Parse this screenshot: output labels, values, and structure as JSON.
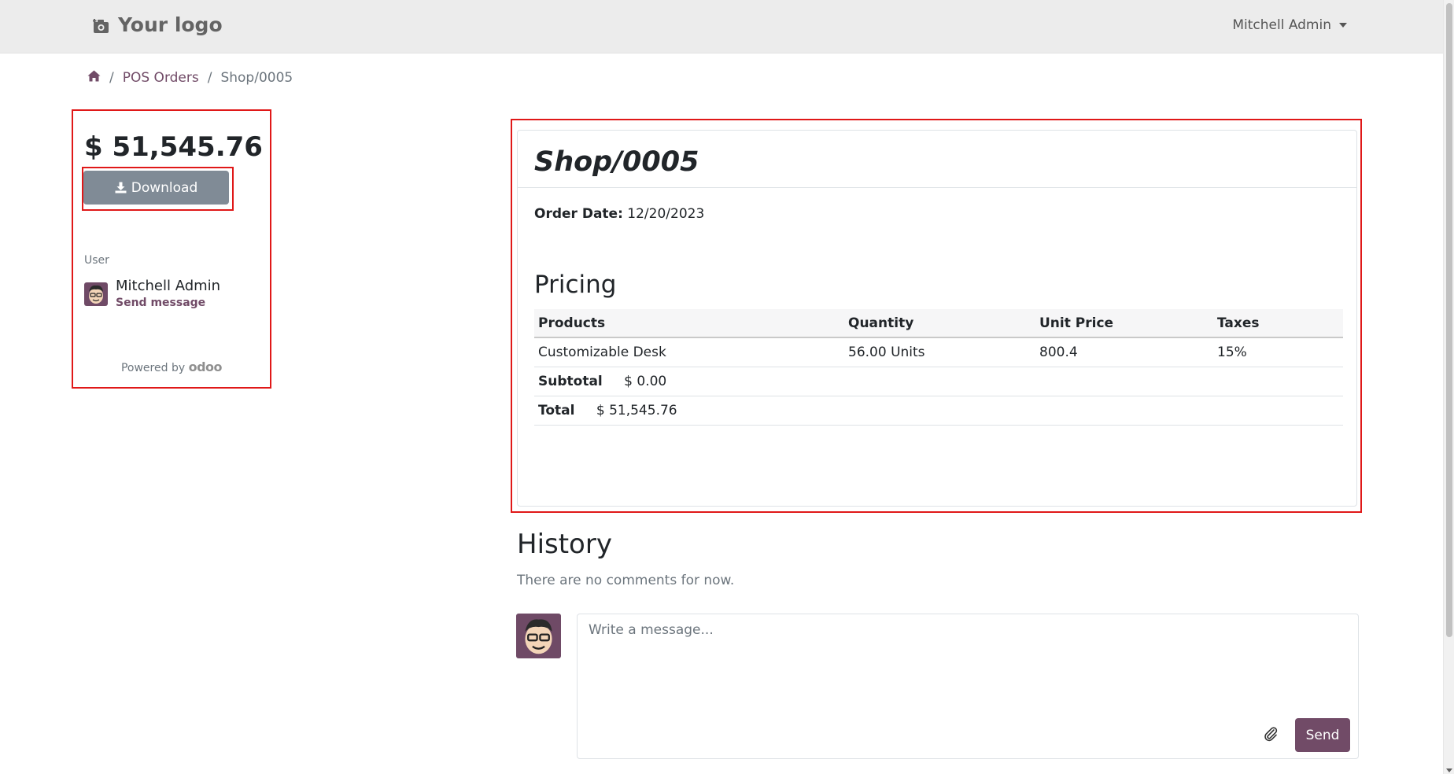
{
  "header": {
    "logo_text": "Your logo",
    "user_name": "Mitchell Admin"
  },
  "breadcrumb": {
    "items": [
      "POS Orders"
    ],
    "current": "Shop/0005",
    "separator": "/"
  },
  "sidebar": {
    "amount": "$ 51,545.76",
    "download_label": "Download",
    "user_label": "User",
    "user_name": "Mitchell Admin",
    "send_message_label": "Send message",
    "powered_by": "Powered by",
    "powered_brand": "odoo"
  },
  "order": {
    "title": "Shop/0005",
    "order_date_label": "Order Date:",
    "order_date_value": "12/20/2023",
    "pricing_title": "Pricing",
    "columns": [
      "Products",
      "Quantity",
      "Unit Price",
      "Taxes"
    ],
    "lines": [
      {
        "product": "Customizable Desk",
        "quantity": "56.00 Units",
        "unit_price": "800.4",
        "taxes": "15%"
      }
    ],
    "subtotal_label": "Subtotal",
    "subtotal_value": "$ 0.00",
    "total_label": "Total",
    "total_value": "$ 51,545.76"
  },
  "history": {
    "title": "History",
    "empty_text": "There are no comments for now.",
    "composer_placeholder": "Write a message...",
    "send_label": "Send"
  },
  "colors": {
    "brand": "#714b67",
    "download_button": "#808b96",
    "highlight_frame": "#e01818",
    "topbar": "#ececec"
  },
  "icons": [
    "camera-icon",
    "home-icon",
    "download-icon",
    "paperclip-icon",
    "caret-down-icon"
  ]
}
